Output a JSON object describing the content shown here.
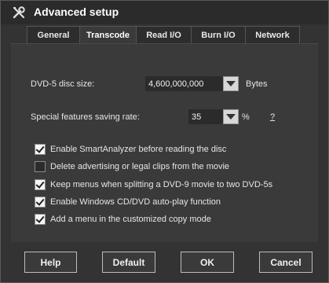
{
  "window": {
    "title": "Advanced setup",
    "title_icon": "tools-icon"
  },
  "tabs": [
    {
      "label": "General",
      "active": false
    },
    {
      "label": "Transcode",
      "active": true
    },
    {
      "label": "Read I/O",
      "active": false
    },
    {
      "label": "Burn I/O",
      "active": false
    },
    {
      "label": "Network",
      "active": false
    }
  ],
  "settings": {
    "disc_size_label": "DVD-5 disc size:",
    "disc_size_value": "4,600,000,000",
    "disc_size_unit": "Bytes",
    "saving_rate_label": "Special features saving rate:",
    "saving_rate_value": "35",
    "saving_rate_unit": "%",
    "help_link": "?"
  },
  "checkboxes": [
    {
      "label": "Enable SmartAnalyzer before reading the disc",
      "checked": true
    },
    {
      "label": "Delete advertising or legal clips from the movie",
      "checked": false
    },
    {
      "label": "Keep menus when splitting a DVD-9 movie to two DVD-5s",
      "checked": true
    },
    {
      "label": "Enable Windows CD/DVD auto-play function",
      "checked": true
    },
    {
      "label": "Add a menu in the customized copy mode",
      "checked": true
    }
  ],
  "buttons": {
    "help": "Help",
    "default": "Default",
    "ok": "OK",
    "cancel": "Cancel"
  }
}
